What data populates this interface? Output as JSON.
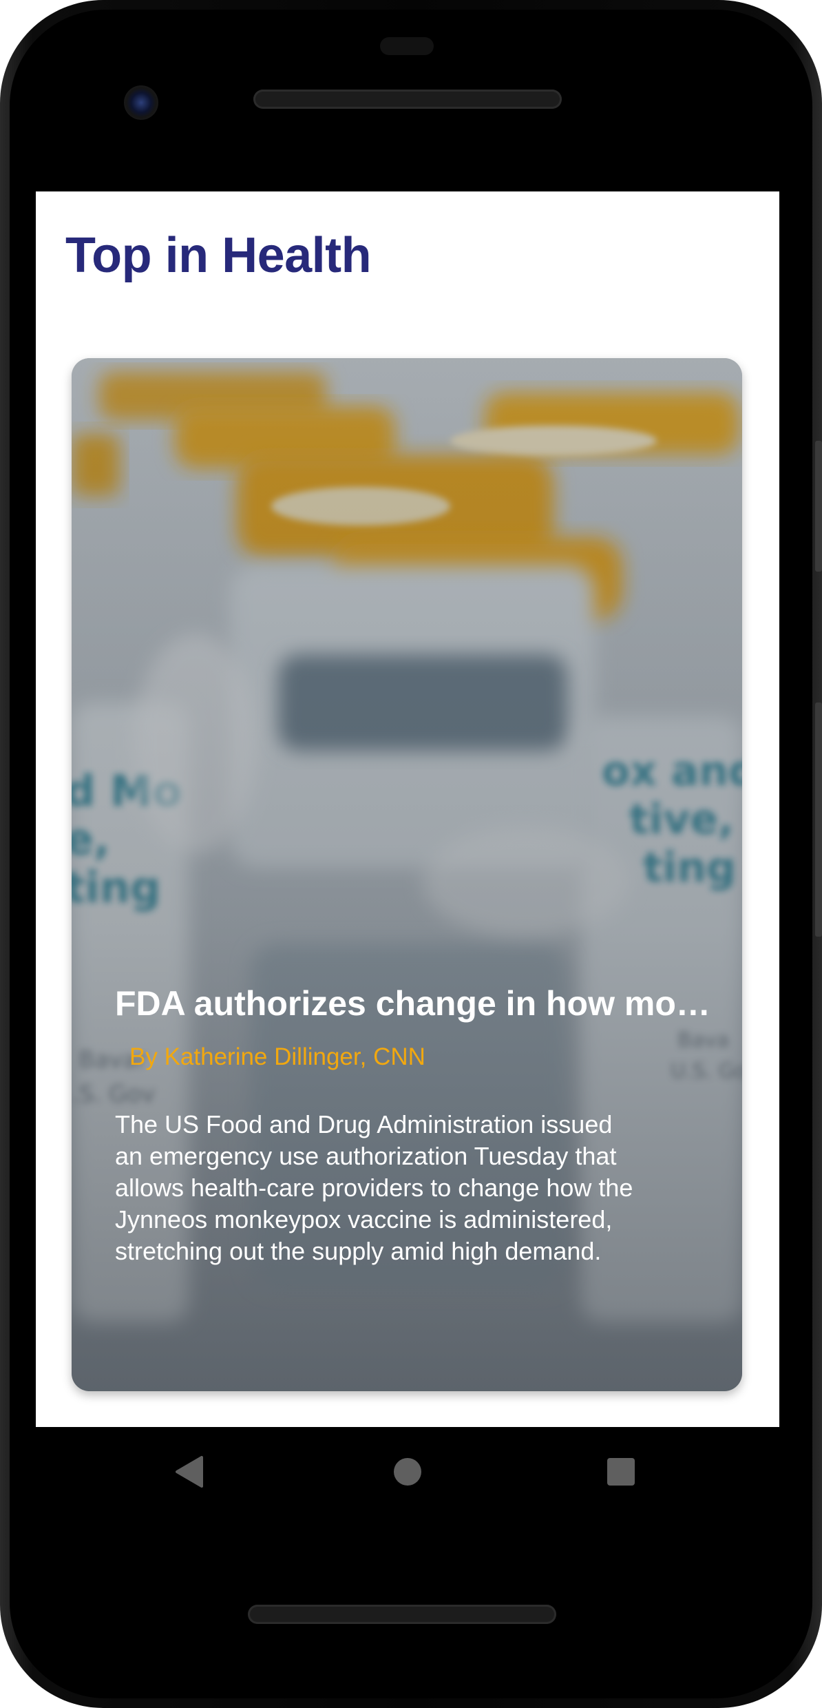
{
  "page": {
    "title": "Top in Health"
  },
  "article": {
    "headline": "FDA authorizes change in how mo…",
    "byline": "By Katherine Dillinger, CNN",
    "summary": "The US Food and Drug Administration issued an emergency use authorization Tuesday that allows health-care providers to change how the Jynneos monkeypox vaccine is administered, stretching out the supply amid high demand.",
    "image_icon": "vaccine-vials-image"
  },
  "navigation": {
    "back_icon": "back-triangle-icon",
    "home_icon": "home-circle-icon",
    "recents_icon": "recents-square-icon"
  },
  "colors": {
    "title": "#27297a",
    "byline": "#f2a80f",
    "headline": "#ffffff"
  }
}
